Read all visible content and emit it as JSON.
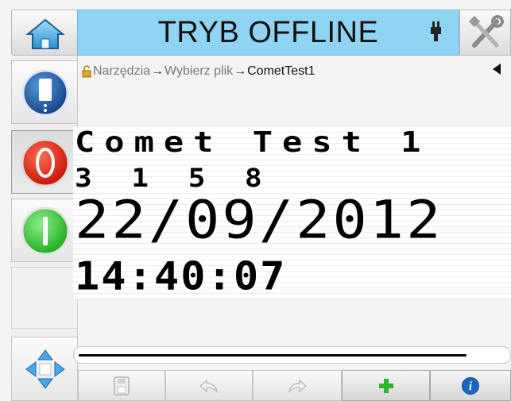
{
  "header": {
    "title": "TRYB OFFLINE",
    "home_icon": "home-icon",
    "status_icon": "ink-cartridge-icon",
    "tools_icon": "tools-icon"
  },
  "sidebar": {
    "items": [
      {
        "name": "printhead-button",
        "icon": "printhead-icon",
        "color": "#1f5fa8"
      },
      {
        "name": "stop-button",
        "icon": "stop-icon",
        "color": "#e02010"
      },
      {
        "name": "start-button",
        "icon": "start-icon",
        "color": "#28c028"
      },
      {
        "name": "empty-slot"
      },
      {
        "name": "navigate-button",
        "icon": "direction-pad-icon",
        "color": "#3a9ad8"
      }
    ]
  },
  "breadcrumb": {
    "items": [
      "Narzędzia",
      "Wybierz plik",
      "CometTest1"
    ]
  },
  "preview": {
    "lines": [
      "Comet Test 1",
      "3 1 5 8",
      "22/09/2012",
      "14:40:07"
    ]
  },
  "toolbar": {
    "buttons": [
      {
        "name": "save-button",
        "icon": "save-icon",
        "enabled": false
      },
      {
        "name": "undo-button",
        "icon": "undo-icon",
        "enabled": false
      },
      {
        "name": "redo-button",
        "icon": "redo-icon",
        "enabled": false
      },
      {
        "name": "add-button",
        "icon": "plus-icon",
        "enabled": true
      },
      {
        "name": "info-button",
        "icon": "info-icon",
        "enabled": true
      }
    ]
  },
  "colors": {
    "title_bar": "#90d4f4",
    "add_icon": "#2db52d",
    "info_icon": "#1a66c0"
  }
}
